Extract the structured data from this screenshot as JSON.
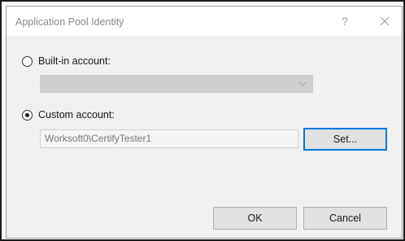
{
  "dialog": {
    "title": "Application Pool Identity",
    "help_label": "?",
    "close_icon": "close-icon"
  },
  "builtin": {
    "label": "Built-in account:",
    "checked": false,
    "combo_value": "",
    "combo_enabled": false
  },
  "custom": {
    "label": "Custom account:",
    "checked": true,
    "value": "Worksoft0\\CertifyTester1",
    "set_label": "Set..."
  },
  "buttons": {
    "ok_label": "OK",
    "cancel_label": "Cancel"
  },
  "colors": {
    "accent": "#0078d7",
    "dialog_bg": "#f0f0f0",
    "titlebar_bg": "#ffffff"
  }
}
